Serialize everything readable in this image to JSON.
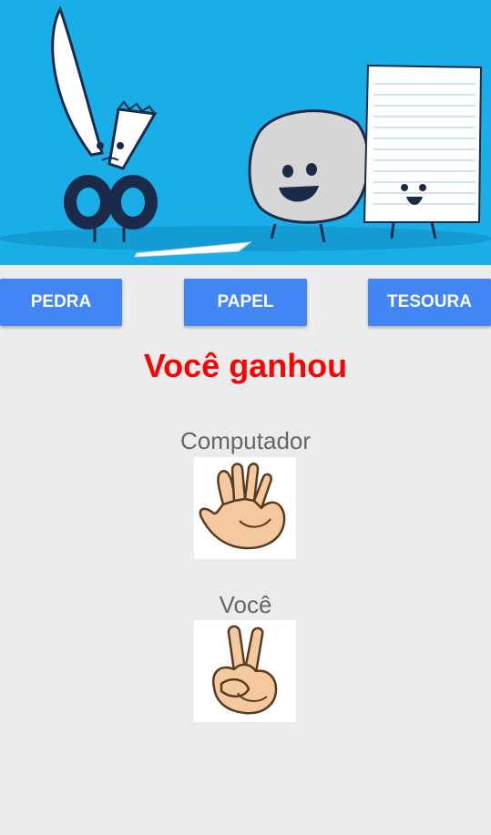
{
  "banner": {
    "image": "rock-paper-scissors-characters-illustration",
    "background_color": "#1aaee8"
  },
  "buttons": {
    "rock": "PEDRA",
    "paper": "PAPEL",
    "scissors": "TESOURA",
    "color": "#4285f4"
  },
  "result": {
    "text": "Você ganhou",
    "color": "#ff0000"
  },
  "computer": {
    "label": "Computador",
    "choice_icon": "open-hand-paper-icon"
  },
  "player": {
    "label": "Você",
    "choice_icon": "victory-hand-scissors-icon"
  }
}
